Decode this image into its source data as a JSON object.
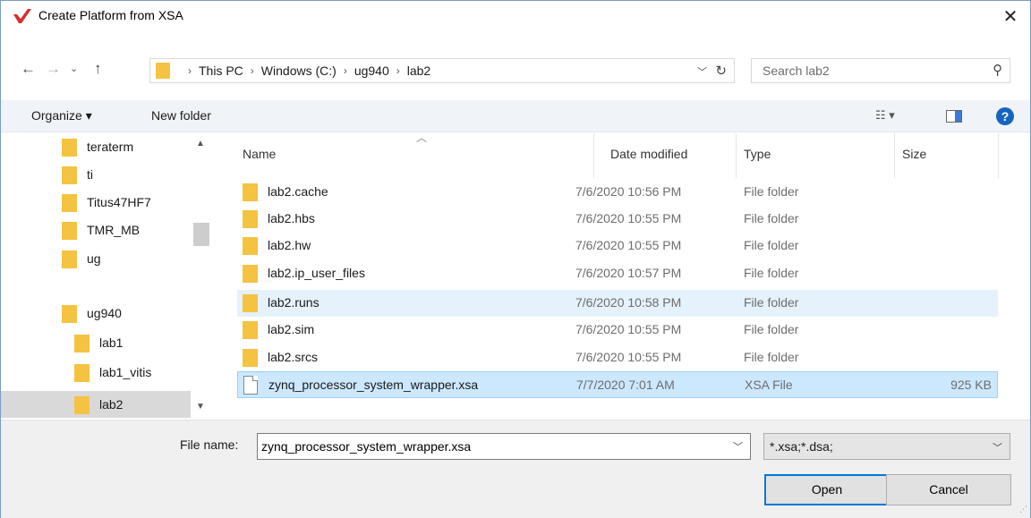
{
  "window": {
    "title": "Create Platform from XSA",
    "close_glyph": "✕"
  },
  "nav_buttons": {
    "back": "←",
    "forward": "→",
    "recent": "⌄",
    "up": "↑"
  },
  "address": {
    "crumbs": [
      "This PC",
      "Windows (C:)",
      "ug940",
      "lab2"
    ],
    "separator": "›"
  },
  "search": {
    "placeholder": "Search lab2"
  },
  "toolbar": {
    "organize_label": "Organize ▾",
    "new_folder_label": "New folder",
    "view_label": "☷ ▾",
    "help_label": "?"
  },
  "nav_pane": {
    "items": [
      {
        "label": "teraterm",
        "indent": 0,
        "selected": false
      },
      {
        "label": "ti",
        "indent": 0,
        "selected": false
      },
      {
        "label": "Titus47HF7",
        "indent": 0,
        "selected": false
      },
      {
        "label": "TMR_MB",
        "indent": 0,
        "selected": false
      },
      {
        "label": "ug",
        "indent": 0,
        "selected": false
      },
      {
        "label": "ug940",
        "indent": 0,
        "selected": false
      },
      {
        "label": "lab1",
        "indent": 1,
        "selected": false
      },
      {
        "label": "lab1_vitis",
        "indent": 1,
        "selected": false
      },
      {
        "label": "lab2",
        "indent": 1,
        "selected": true
      }
    ]
  },
  "columns": {
    "name": "Name",
    "date": "Date modified",
    "type": "Type",
    "size": "Size"
  },
  "files": [
    {
      "name": "lab2.cache",
      "date": "7/6/2020 10:56 PM",
      "type": "File folder",
      "size": "",
      "kind": "folder",
      "state": ""
    },
    {
      "name": "lab2.hbs",
      "date": "7/6/2020 10:55 PM",
      "type": "File folder",
      "size": "",
      "kind": "folder",
      "state": ""
    },
    {
      "name": "lab2.hw",
      "date": "7/6/2020 10:55 PM",
      "type": "File folder",
      "size": "",
      "kind": "folder",
      "state": ""
    },
    {
      "name": "lab2.ip_user_files",
      "date": "7/6/2020 10:57 PM",
      "type": "File folder",
      "size": "",
      "kind": "folder",
      "state": ""
    },
    {
      "name": "lab2.runs",
      "date": "7/6/2020 10:58 PM",
      "type": "File folder",
      "size": "",
      "kind": "folder",
      "state": "hover"
    },
    {
      "name": "lab2.sim",
      "date": "7/6/2020 10:55 PM",
      "type": "File folder",
      "size": "",
      "kind": "folder",
      "state": ""
    },
    {
      "name": "lab2.srcs",
      "date": "7/6/2020 10:55 PM",
      "type": "File folder",
      "size": "",
      "kind": "folder",
      "state": ""
    },
    {
      "name": "zynq_processor_system_wrapper.xsa",
      "date": "7/7/2020 7:01 AM",
      "type": "XSA File",
      "size": "925 KB",
      "kind": "file",
      "state": "selected"
    }
  ],
  "bottom": {
    "file_name_label": "File name:",
    "file_name_value": "zynq_processor_system_wrapper.xsa",
    "file_type_value": "*.xsa;*.dsa;",
    "open_label": "Open",
    "cancel_label": "Cancel"
  }
}
